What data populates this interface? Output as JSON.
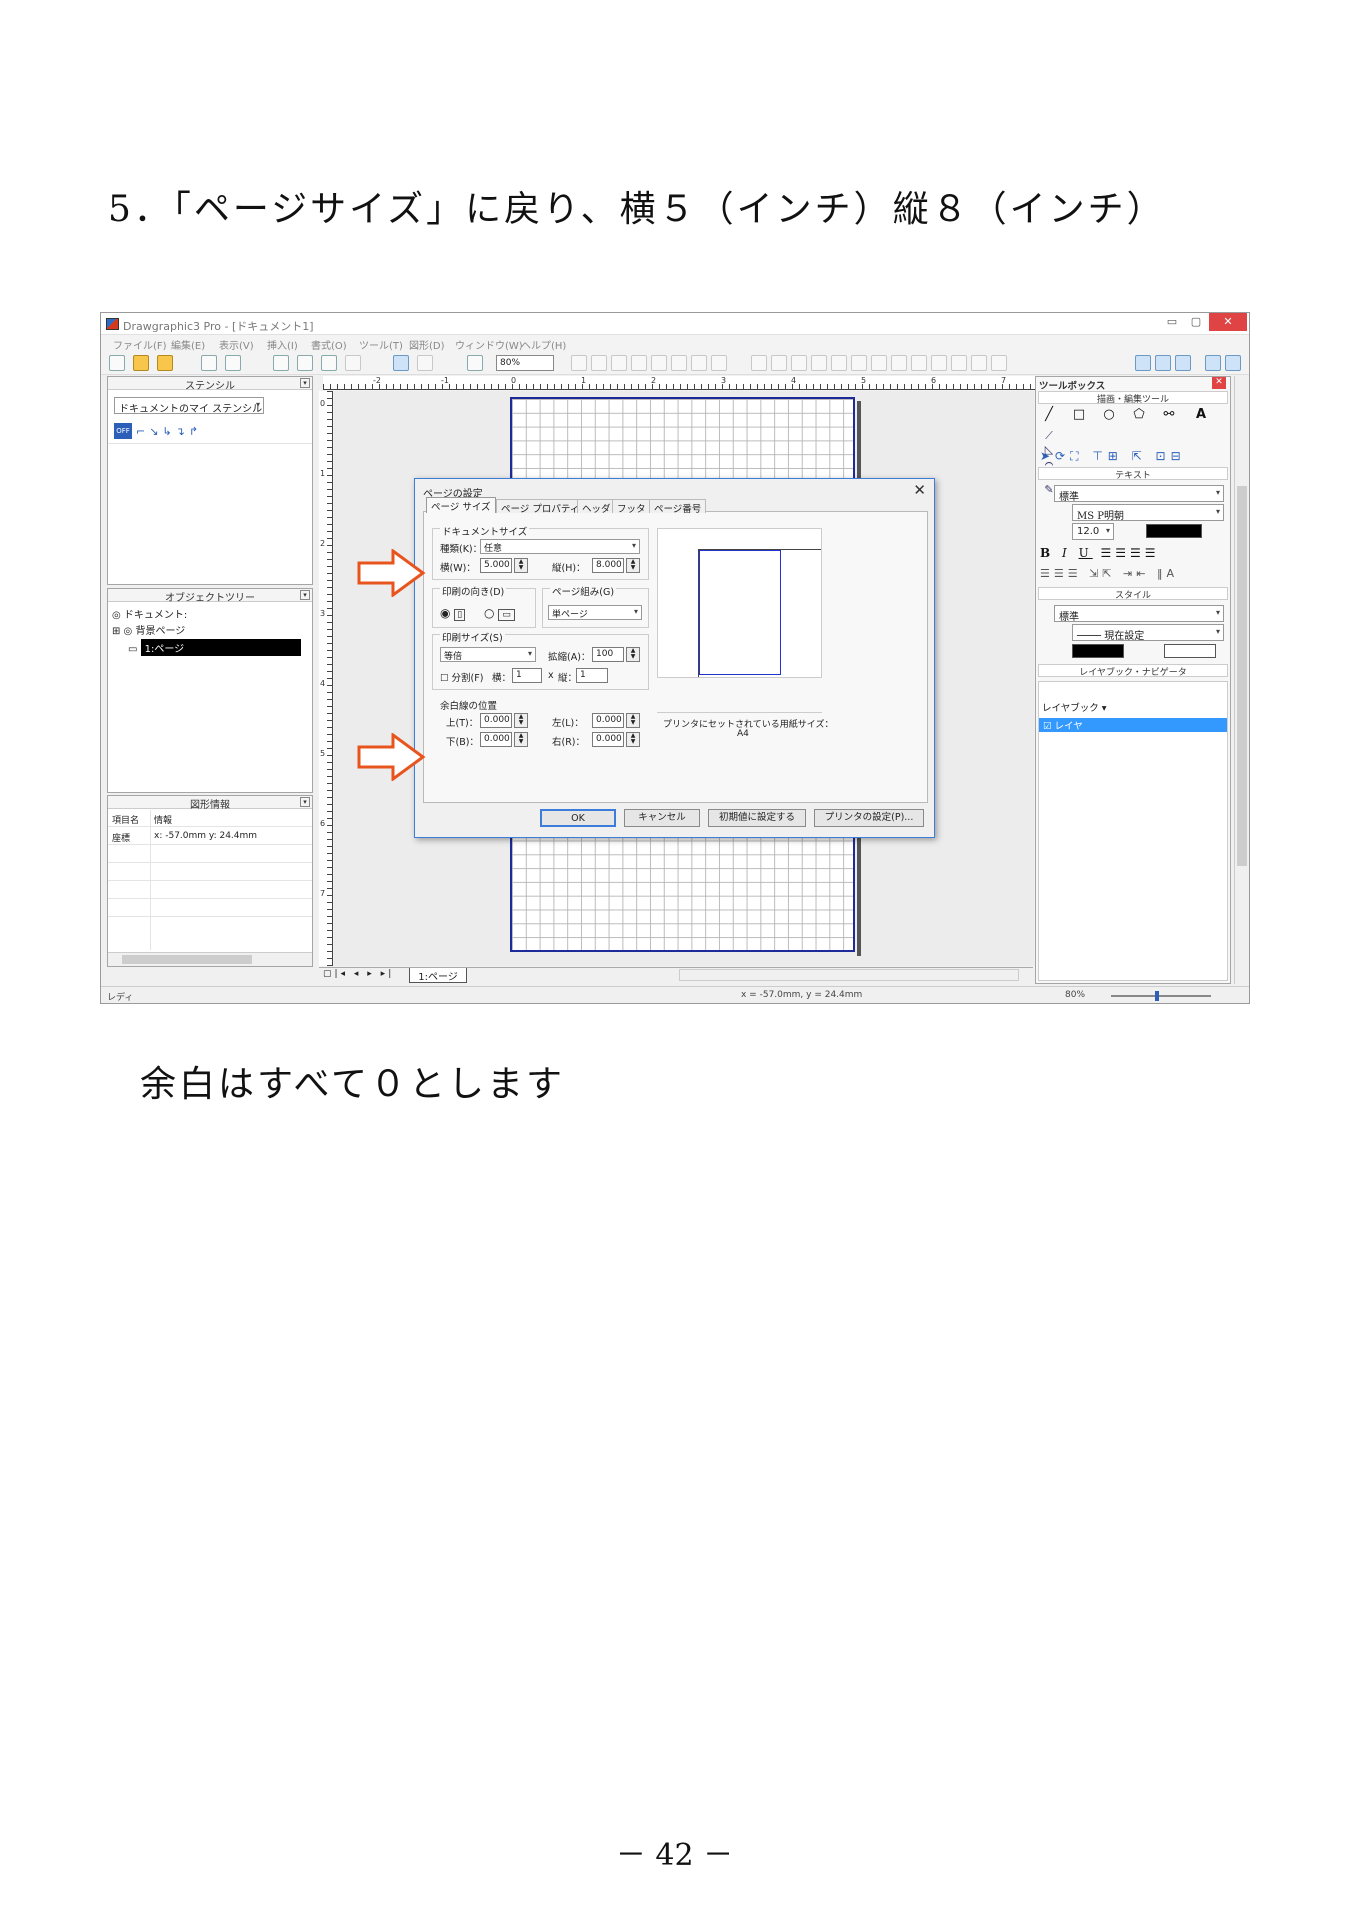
{
  "doc": {
    "heading": "5．「ページサイズ」に戻り、横５（インチ）縦８（インチ）",
    "note": "余白はすべて０とします",
    "page_number": "－ 42 －"
  },
  "app": {
    "title": "Drawgraphic3 Pro - [ドキュメント1]",
    "window_buttons": [
      "▭",
      "▢",
      "✕"
    ],
    "menus": [
      "ファイル(F)",
      "編集(E)",
      "表示(V)",
      "挿入(I)",
      "書式(O)",
      "ツール(T)",
      "図形(D)",
      "ウィンドウ(W)",
      "ヘルプ(H)"
    ],
    "zoom": "80%",
    "stencil": {
      "title": "ステンシル",
      "dropdown": "ドキュメントのマイ ステンシル",
      "off_label": "OFF"
    },
    "object_tree": {
      "title": "オブジェクトツリー",
      "items": [
        "ドキュメント:",
        "背景ページ",
        "1:ページ"
      ]
    },
    "shape_info": {
      "title": "図形情報",
      "col_name": "項目名",
      "col_info": "情報",
      "row_name": "座標",
      "row_value": "x: -57.0mm y: 24.4mm"
    },
    "ruler_numbers": [
      "-2",
      "-1",
      "0",
      "1",
      "2",
      "3",
      "4",
      "5",
      "6",
      "7"
    ],
    "ruler_left_numbers": [
      "0",
      "1",
      "2",
      "3",
      "4",
      "5",
      "6",
      "7"
    ],
    "page_tab": "1:ページ",
    "status": {
      "ready": "レディ",
      "coords": "x = -57.0mm, y = 24.4mm",
      "zoom": "80%"
    },
    "toolbox": {
      "title": "ツールボックス",
      "section_draw": "描画・編集ツール",
      "section_text": "テキスト",
      "section_style": "スタイル",
      "section_layer": "レイヤブック・ナビゲータ",
      "text_style": "標準",
      "font": "MS P明朝",
      "font_size": "12.0",
      "line_style": "標準",
      "line_setting": "現在設定",
      "layerbook": "レイヤブック",
      "layer": "レイヤ"
    }
  },
  "dialog": {
    "title": "ページの設定",
    "tabs": [
      "ページ サイズ",
      "ページ プロパティ",
      "ヘッダ",
      "フッタ",
      "ページ番号"
    ],
    "doc_size_group": "ドキュメントサイズ",
    "type_label": "種類(K)：",
    "type_value": "任意",
    "width_label": "横(W)：",
    "width_value": "5.000",
    "height_label": "縦(H)：",
    "height_value": "8.000",
    "orientation_group": "印刷の向き(D)",
    "layout_group": "ページ組み(G)",
    "layout_value": "単ページ",
    "print_size_group": "印刷サイズ(S)",
    "print_size_value": "等倍",
    "scale_label": "拡縮(A)：",
    "scale_value": "100",
    "split_label": "分割(F)",
    "split_h_label": "横：",
    "split_h_value": "1",
    "split_x": "x",
    "split_v_label": "縦：",
    "split_v_value": "1",
    "margin_group": "余白線の位置",
    "top_label": "上(T)：",
    "top_value": "0.000",
    "left_label": "左(L)：",
    "left_value": "0.000",
    "bottom_label": "下(B)：",
    "bottom_value": "0.000",
    "right_label": "右(R)：",
    "right_value": "0.000",
    "printer_paper_label": "プリンタにセットされている用紙サイズ：",
    "printer_paper_value": "A4",
    "buttons": [
      "OK",
      "キャンセル",
      "初期値に設定する",
      "プリンタの設定(P)..."
    ]
  },
  "colors": {
    "arrow": "#e8541e",
    "page_border": "#1c2a9a",
    "selection": "#000000",
    "dialog_border": "#3b7dd8",
    "close_button": "#e04343",
    "layer_highlight": "#3399ff"
  },
  "icons": [
    "app-icon",
    "new-file-icon",
    "open-folder-icon",
    "save-icon",
    "print-icon",
    "print-preview-icon",
    "cut-icon",
    "copy-icon",
    "paste-icon",
    "undo-icon",
    "redo-icon",
    "zoom-icon",
    "arrow-icon"
  ]
}
